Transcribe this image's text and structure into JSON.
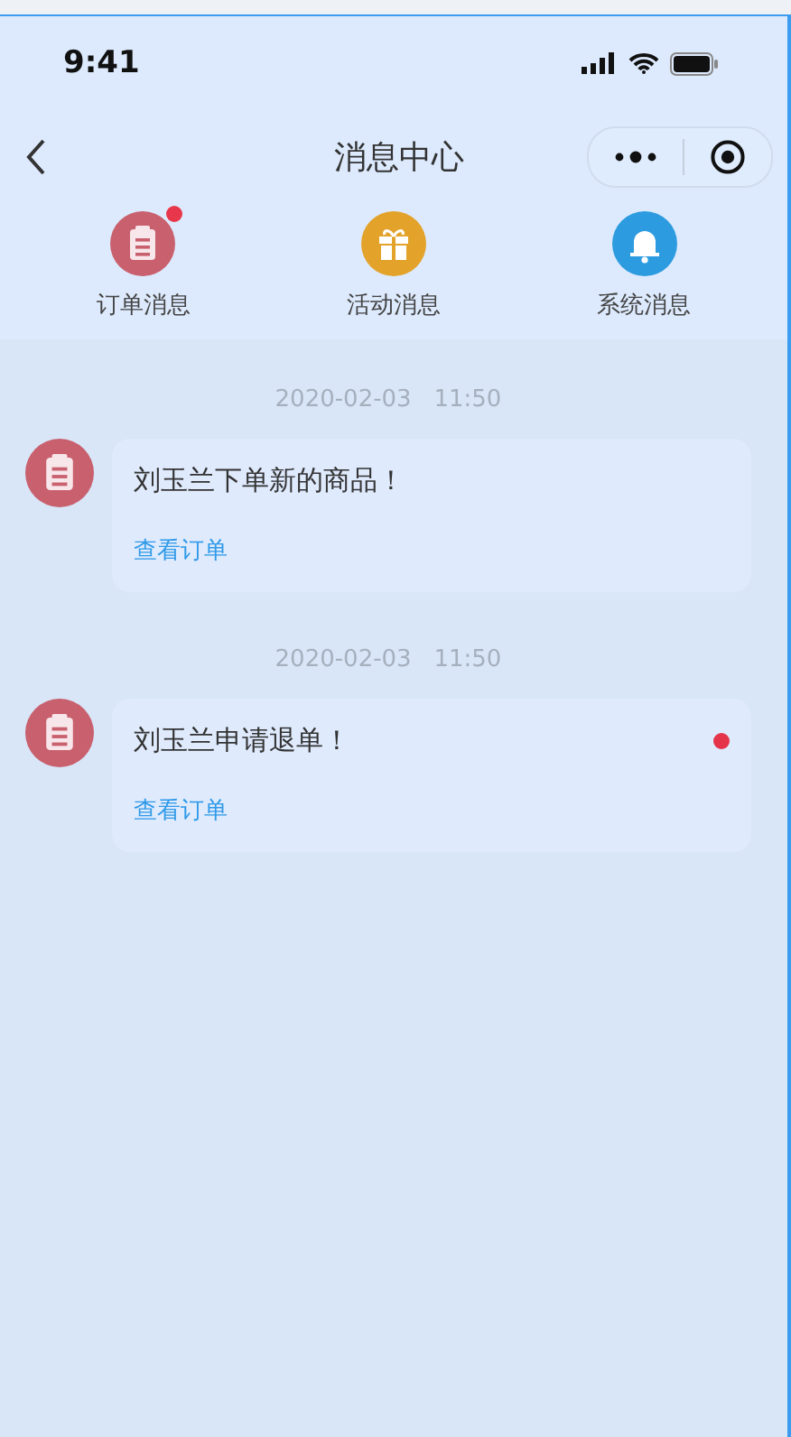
{
  "status_bar": {
    "time": "9:41"
  },
  "nav": {
    "title": "消息中心"
  },
  "categories": [
    {
      "label": "订单消息",
      "kind": "clipboard",
      "color": "#c9606e",
      "unread": true
    },
    {
      "label": "活动消息",
      "kind": "gift",
      "color": "#e3a22a",
      "unread": false
    },
    {
      "label": "系统消息",
      "kind": "bell",
      "color": "#2d9be0",
      "unread": false
    }
  ],
  "messages": [
    {
      "time": "2020-02-03   11:50",
      "text": "刘玉兰下单新的商品！",
      "link": "查看订单",
      "unread": false
    },
    {
      "time": "2020-02-03   11:50",
      "text": "刘玉兰申请退单！",
      "link": "查看订单",
      "unread": true
    }
  ]
}
